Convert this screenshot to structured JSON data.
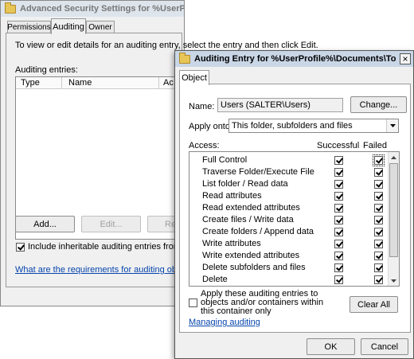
{
  "bg_window": {
    "title": "Advanced Security Settings for %UserProfile%\\Documents\\Top Secret",
    "tabs": [
      {
        "label": "Permissions",
        "active": false
      },
      {
        "label": "Auditing",
        "active": true
      },
      {
        "label": "Owner",
        "active": false
      }
    ],
    "instruction": "To view or edit details for an auditing entry, select the entry and then click Edit.",
    "entries_label": "Auditing entries:",
    "columns": [
      "Type",
      "Name",
      "Ac"
    ],
    "add_button": "Add...",
    "edit_button": "Edit...",
    "remove_button": "Re",
    "inherit_checkbox": {
      "label": "Include inheritable auditing entries from this obj",
      "checked": true
    },
    "requirements_link": "What are the requirements for auditing object acce"
  },
  "dialog": {
    "title": "Auditing Entry for %UserProfile%\\Documents\\Top Sec...",
    "close_glyph": "×",
    "tab": "Object",
    "name_label": "Name:",
    "name_value": "Users (SALTER\\Users)",
    "change_button": "Change...",
    "apply_onto_label": "Apply onto:",
    "apply_onto_value": "This folder, subfolders and files",
    "access_header": "Access:",
    "successful_header": "Successful",
    "failed_header": "Failed",
    "access_rows": [
      {
        "label": "Full Control",
        "successful": true,
        "failed": true
      },
      {
        "label": "Traverse Folder/Execute File",
        "successful": true,
        "failed": true
      },
      {
        "label": "List folder / Read data",
        "successful": true,
        "failed": true
      },
      {
        "label": "Read attributes",
        "successful": true,
        "failed": true
      },
      {
        "label": "Read extended attributes",
        "successful": true,
        "failed": true
      },
      {
        "label": "Create files / Write data",
        "successful": true,
        "failed": true
      },
      {
        "label": "Create folders / Append data",
        "successful": true,
        "failed": true
      },
      {
        "label": "Write attributes",
        "successful": true,
        "failed": true
      },
      {
        "label": "Write extended attributes",
        "successful": true,
        "failed": true
      },
      {
        "label": "Delete subfolders and files",
        "successful": true,
        "failed": true
      },
      {
        "label": "Delete",
        "successful": true,
        "failed": true
      }
    ],
    "apply_checkbox": {
      "label": "Apply these auditing entries to objects and/or containers within this container only",
      "checked": false
    },
    "clear_all_button": "Clear All",
    "managing_link": "Managing auditing",
    "ok_button": "OK",
    "cancel_button": "Cancel"
  },
  "colors": {
    "dialog_title_bg": "#c9d6e6",
    "bg_title_bg": "#dde4ec",
    "window_bg": "#f0f0f0",
    "link": "#0645ad"
  }
}
